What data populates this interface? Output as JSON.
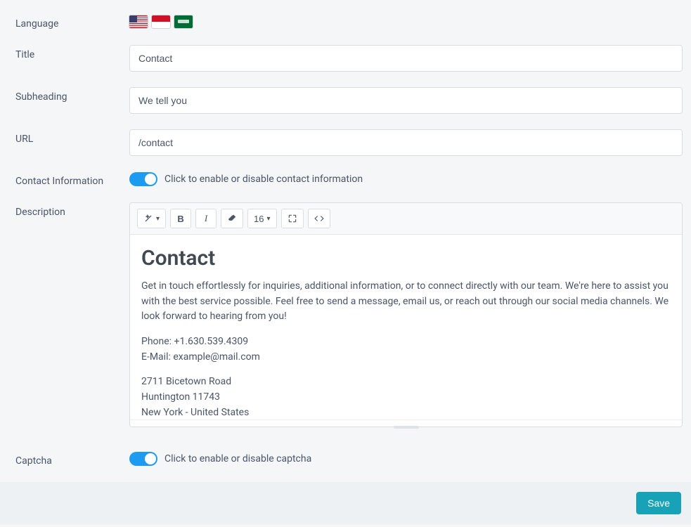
{
  "labels": {
    "language": "Language",
    "title": "Title",
    "subheading": "Subheading",
    "url": "URL",
    "contact_info": "Contact Information",
    "description": "Description",
    "captcha": "Captcha"
  },
  "fields": {
    "title": "Contact",
    "subheading": "We tell you",
    "url": "/contact"
  },
  "toggles": {
    "contact_info_label": "Click to enable or disable contact information",
    "captcha_label": "Click to enable or disable captcha"
  },
  "toolbar": {
    "font_size": "16"
  },
  "editor": {
    "heading": "Contact",
    "intro": "Get in touch effortlessly for inquiries, additional information, or to connect directly with our team. We're here to assist you with the best service possible. Feel free to send a message, email us, or reach out through our social media channels. We look forward to hearing from you!",
    "phone": "Phone: +1.630.539.4309",
    "email": "E-Mail: example@mail.com",
    "addr1": "2711 Bicetown Road",
    "addr2": "Huntington 11743",
    "addr3": "New York - United States"
  },
  "footer": {
    "save": "Save"
  }
}
